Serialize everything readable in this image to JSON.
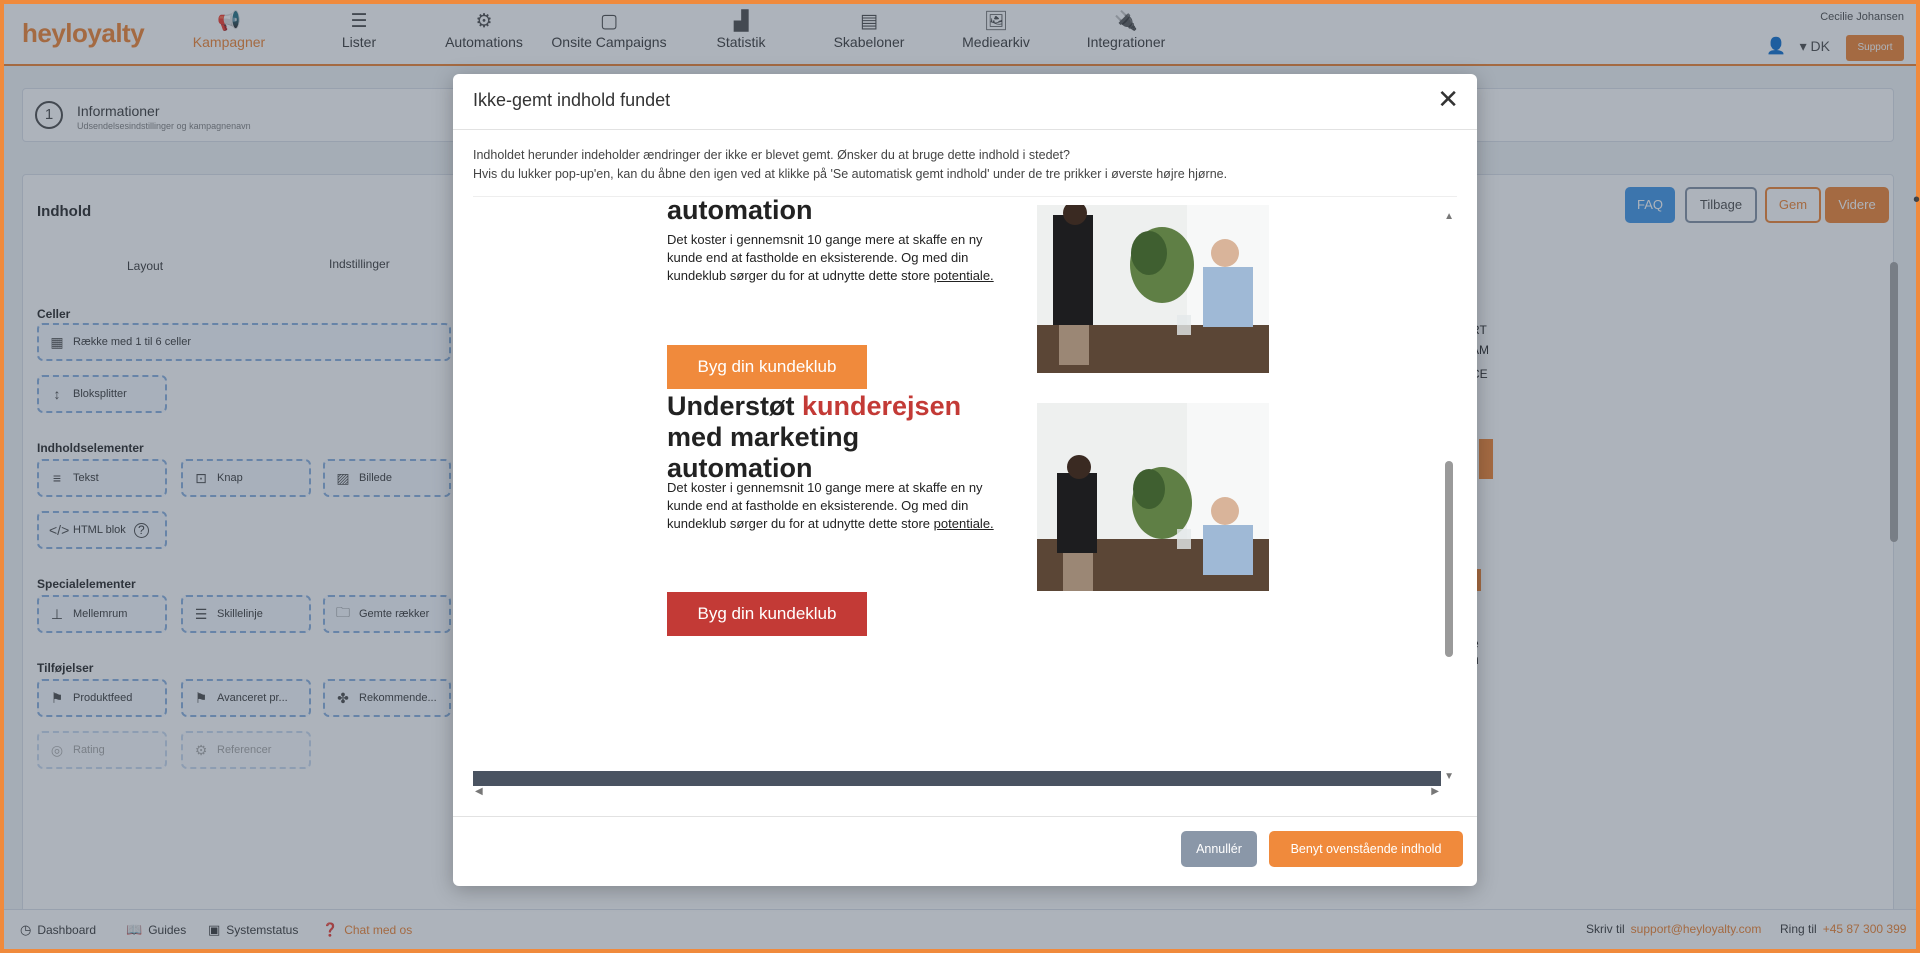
{
  "brand": {
    "logo_text": "heyloyalty",
    "accent": "#f08a3c",
    "danger": "#c33a36"
  },
  "nav": {
    "items": [
      {
        "label": "Kampagner",
        "icon": "megaphone-icon",
        "active": true
      },
      {
        "label": "Lister",
        "icon": "list-icon",
        "active": false
      },
      {
        "label": "Automations",
        "icon": "gears-icon",
        "active": false
      },
      {
        "label": "Onsite Campaigns",
        "icon": "window-icon",
        "active": false
      },
      {
        "label": "Statistik",
        "icon": "bar-chart-icon",
        "active": false
      },
      {
        "label": "Skabeloner",
        "icon": "template-icon",
        "active": false
      },
      {
        "label": "Mediearkiv",
        "icon": "image-icon",
        "active": false
      },
      {
        "label": "Integrationer",
        "icon": "plug-icon",
        "active": false
      }
    ],
    "user_name": "Cecilie Johansen",
    "language": "▾ DK",
    "support_label": "Support"
  },
  "info_step": {
    "number": "1",
    "title": "Informationer",
    "subtitle": "Udsendelsesindstillinger og kampagnenavn"
  },
  "content": {
    "title": "Indhold",
    "tabs": {
      "layout": "Layout",
      "settings": "Indstillinger"
    },
    "sections": {
      "cells": "Celler",
      "content_elements": "Indholdselementer",
      "special_elements": "Specialelementer",
      "addons": "Tilføjelser"
    },
    "palette": {
      "row_cells": "Række med 1 til 6 celler",
      "block_splitter": "Bloksplitter",
      "text": "Tekst",
      "button": "Knap",
      "image": "Billede",
      "html_block": "HTML blok",
      "spacing": "Mellemrum",
      "divider": "Skillelinje",
      "saved_rows": "Gemte rækker",
      "product_feed": "Produktfeed",
      "advanced_product": "Avanceret pr...",
      "recommendations": "Rekommende...",
      "rating": "Rating",
      "reference": "Referencer"
    },
    "header_buttons": {
      "faq": "FAQ",
      "back": "Tilbage",
      "save": "Gem",
      "next": "Videre"
    },
    "bg_snippets": [
      "RT",
      "AM",
      "CE",
      "e",
      "n"
    ]
  },
  "footer": {
    "dashboard": "Dashboard",
    "guides": "Guides",
    "system_status": "Systemstatus",
    "chat": "Chat med os",
    "write_prefix": "Skriv til",
    "support_email": "support@heyloyalty.com",
    "call_prefix": "Ring til",
    "phone": "+45 87 300 399"
  },
  "modal": {
    "title": "Ikke-gemt indhold fundet",
    "message_line1": "Indholdet herunder indeholder ændringer der ikke er blevet gemt. Ønsker du at bruge dette indhold i stedet?",
    "message_line2": "Hvis du lukker pop-up'en, kan du åbne den igen ved at klikke på 'Se automatisk gemt indhold' under de tre prikker i øverste højre hjørne.",
    "cancel_label": "Annullér",
    "apply_label": "Benyt ovenstående indhold",
    "preview": {
      "block1": {
        "heading_tail": "automation",
        "body": "Det koster i gennemsnit 10 gange mere at skaffe en ny kunde end at fastholde en eksisterende. Og med din kundeklub sørger du for at udnytte dette store",
        "body_link": "potentiale.",
        "button": "Byg din kundeklub"
      },
      "block2": {
        "heading_part1": "Understøt",
        "heading_accent": "kunderejsen",
        "heading_line2": "med marketing",
        "heading_line3": "automation",
        "body": "Det koster i gennemsnit 10 gange mere at skaffe en ny kunde end at fastholde en eksisterende. Og med din kundeklub sørger du for at udnytte dette store",
        "body_link": "potentiale.",
        "button": "Byg din kundeklub"
      }
    }
  }
}
